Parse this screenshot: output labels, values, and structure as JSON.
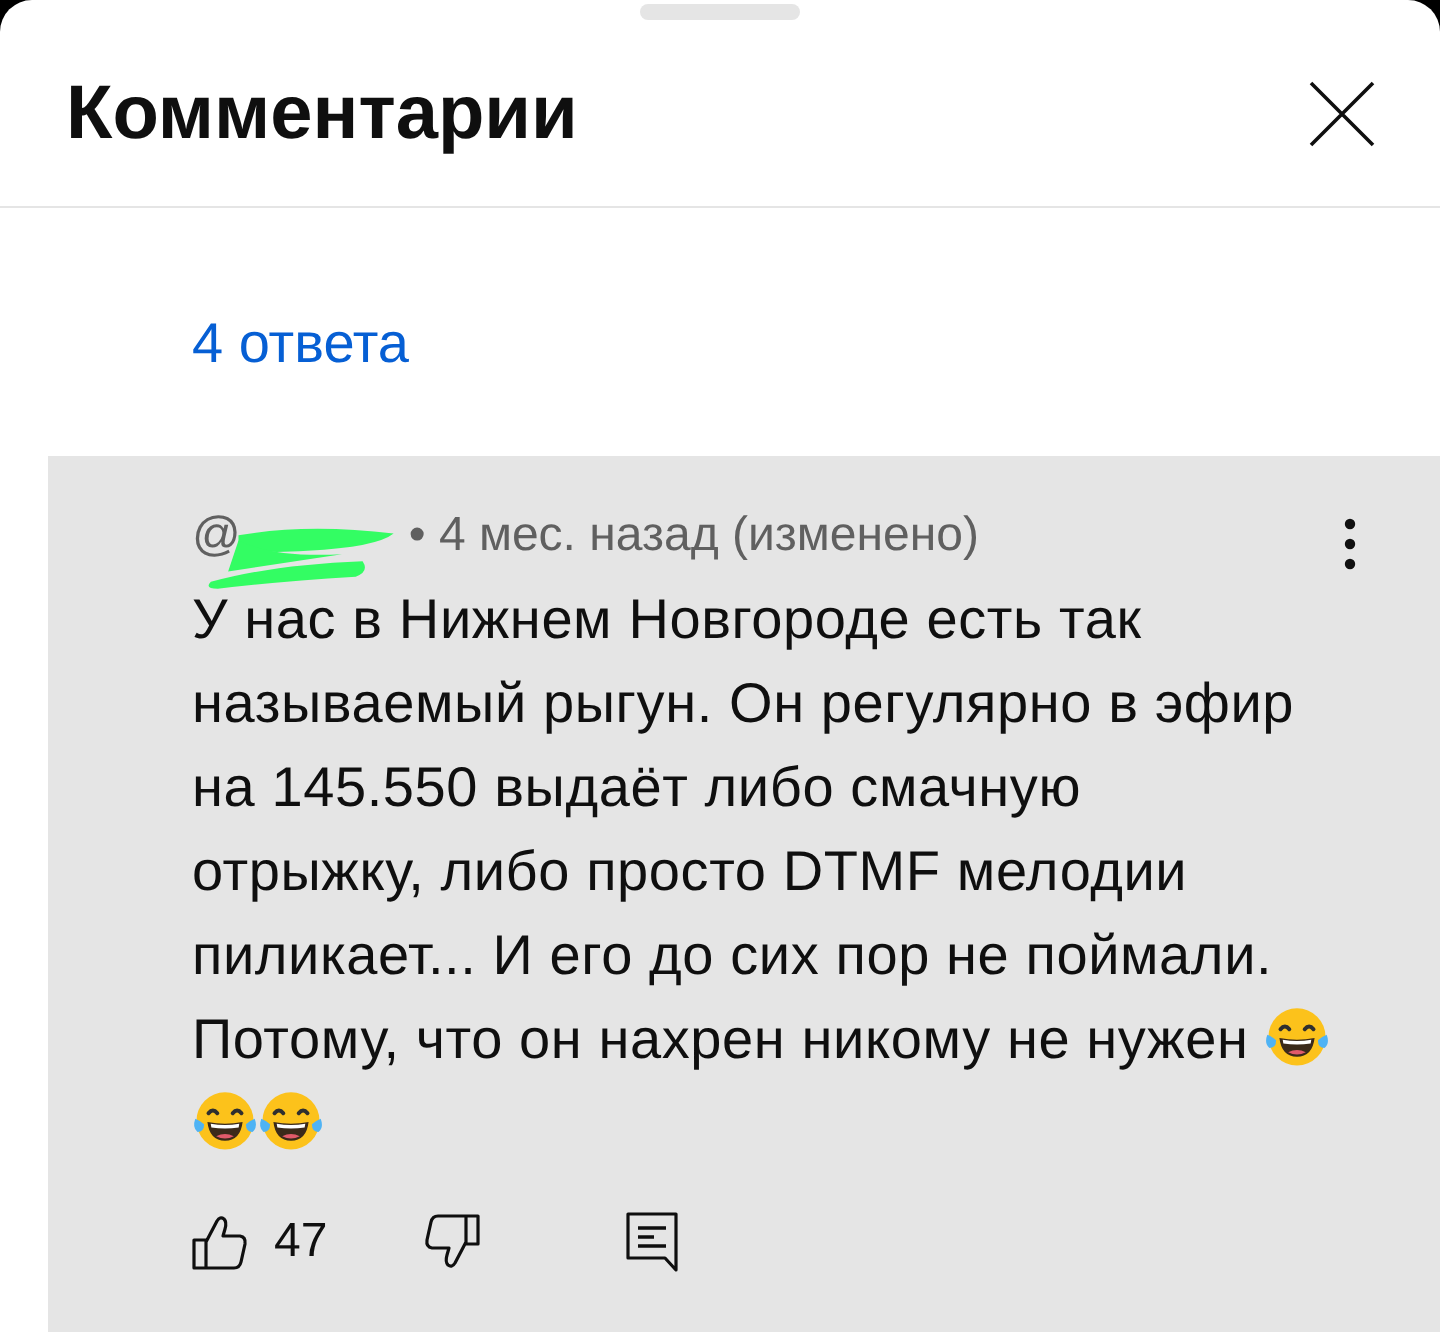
{
  "sheet": {
    "title": "Комментарии"
  },
  "replies_link": "4 ответа",
  "comment": {
    "author": "@",
    "meta": "• 4 мес. назад (изменено)",
    "body": [
      {
        "kind": "text",
        "text": "У нас в Нижнем Новгороде есть так называемый рыгун. Он регулярно в эфир на 145.550 выдаёт либо смачную отрыжку, либо просто DTMF мелодии пиликает... И его до сих пор не поймали."
      },
      {
        "kind": "text",
        "text": "Потому, что он нахрен никому не нужен"
      },
      {
        "kind": "emoji"
      },
      {
        "kind": "emoji"
      },
      {
        "kind": "emoji"
      }
    ],
    "likes": "47"
  }
}
